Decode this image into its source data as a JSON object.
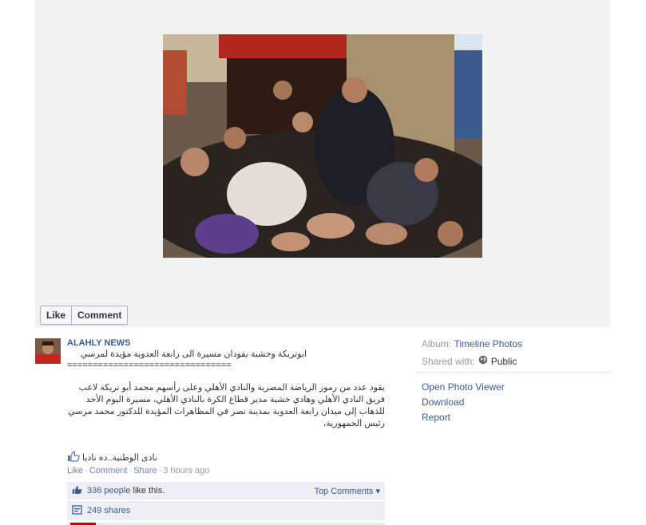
{
  "actions": {
    "like": "Like",
    "comment": "Comment"
  },
  "post": {
    "author": "ALAHLY NEWS",
    "title": "ابوتريكة وخشبة يقودان مسيرة الى رابعة العدوية مؤيدة لمرسي",
    "separator": "================================",
    "body": "يقود عدد من رموز الرياضة المصرية والنادي الأهلي وعلى رأسهم محمد أبو تريكة لاعب فريق النادي الأهلي وهادي خشبة مدير قطاع الكرة بالنادي الأهلي، مسيرة اليوم الأحد للذهاب إلى ميدان رابعة العدوية بمدينة نصر في المظاهرات المؤيدة للدكتور محمد مرسي رئيس الجمهورية،",
    "liked_by": "نادى الوطنية..ده ناديا",
    "meta": {
      "like": "Like",
      "comment": "Comment",
      "share": "Share",
      "time": "3 hours ago"
    }
  },
  "ufi": {
    "likes_link": "336 people",
    "likes_suffix": "like this.",
    "top_comments": "Top Comments ▾",
    "shares": "249 shares"
  },
  "sidebar": {
    "album_label": "Album:",
    "album_value": "Timeline Photos",
    "shared_label": "Shared with:",
    "shared_value": "Public",
    "links": [
      "Open Photo Viewer",
      "Download",
      "Report"
    ]
  }
}
